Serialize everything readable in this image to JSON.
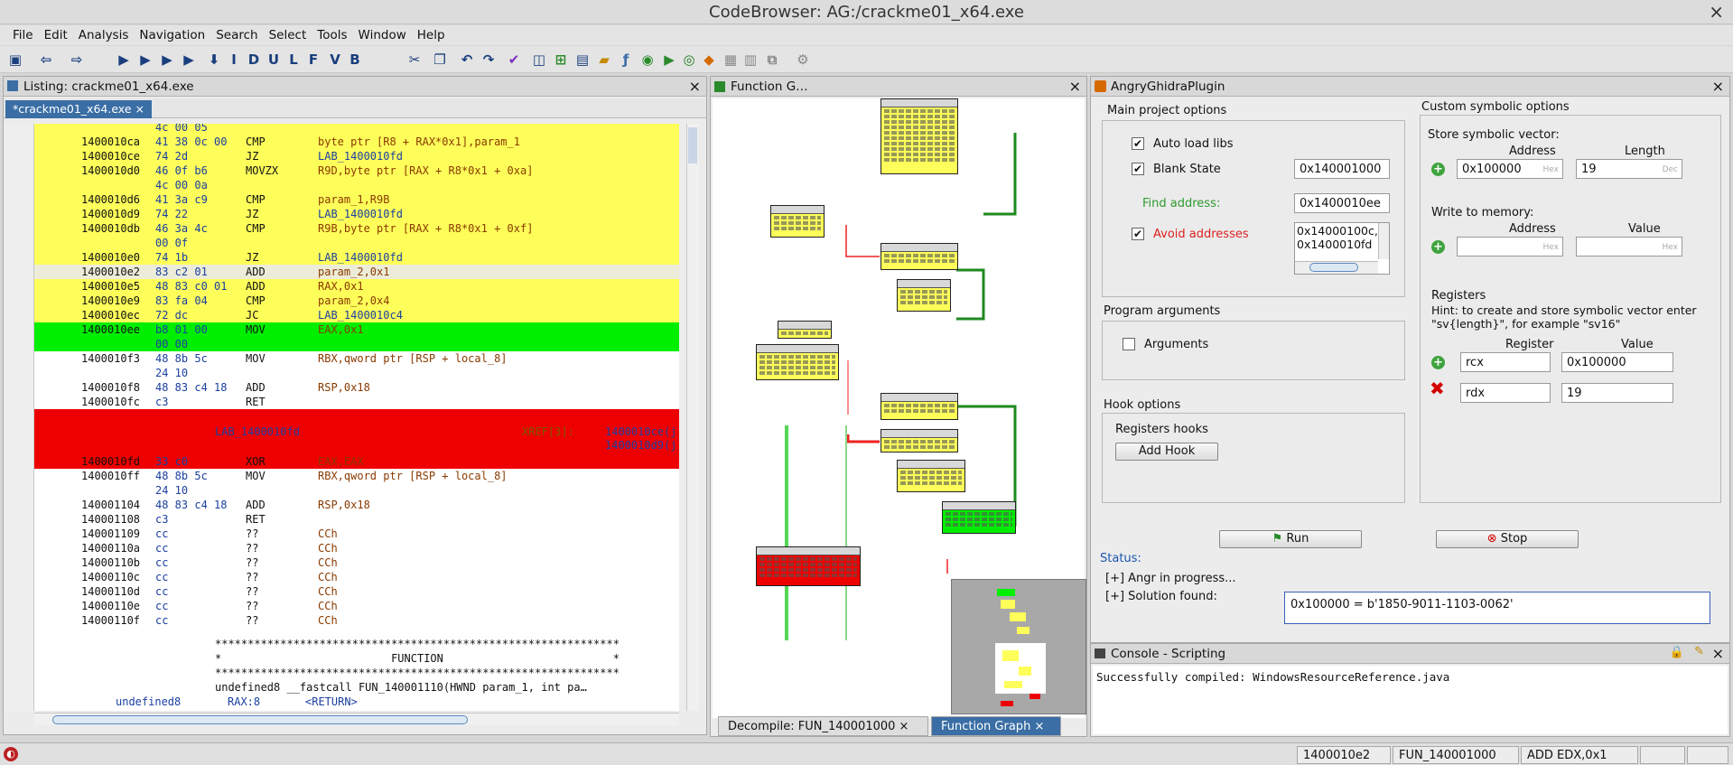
{
  "window": {
    "title": "CodeBrowser: AG:/crackme01_x64.exe",
    "close_glyph": "×"
  },
  "menu": [
    "File",
    "Edit",
    "Analysis",
    "Navigation",
    "Search",
    "Select",
    "Tools",
    "Window",
    "Help"
  ],
  "toolbar": {
    "letters": [
      "I",
      "D",
      "U",
      "L",
      "F",
      "V",
      "B"
    ]
  },
  "listing": {
    "title": "Listing:  crackme01_x64.exe",
    "tab": "*crackme01_x64.exe",
    "rows": [
      {
        "bytes": "4c 00 05",
        "hl": "yellow"
      },
      {
        "addr": "1400010ca",
        "bytes": "41 38 0c 00",
        "mn": "CMP",
        "op": "byte ptr [R8 + RAX*0x1],param_1",
        "hl": "yellow"
      },
      {
        "addr": "1400010ce",
        "bytes": "74 2d",
        "mn": "JZ",
        "op": "LAB_1400010fd",
        "hl": "yellow"
      },
      {
        "addr": "1400010d0",
        "bytes": "46 0f b6",
        "mn": "MOVZX",
        "op": "R9D,byte ptr [RAX + R8*0x1 + 0xa]",
        "hl": "yellow"
      },
      {
        "bytes": "4c 00 0a",
        "hl": "yellow"
      },
      {
        "addr": "1400010d6",
        "bytes": "41 3a c9",
        "mn": "CMP",
        "op": "param_1,R9B",
        "hl": "yellow"
      },
      {
        "addr": "1400010d9",
        "bytes": "74 22",
        "mn": "JZ",
        "op": "LAB_1400010fd",
        "hl": "yellow"
      },
      {
        "addr": "1400010db",
        "bytes": "46 3a 4c",
        "mn": "CMP",
        "op": "R9B,byte ptr [RAX + R8*0x1 + 0xf]",
        "hl": "yellow"
      },
      {
        "bytes": "00 0f",
        "hl": "yellow"
      },
      {
        "addr": "1400010e0",
        "bytes": "74 1b",
        "mn": "JZ",
        "op": "LAB_1400010fd",
        "hl": "yellow"
      },
      {
        "addr": "1400010e2",
        "bytes": "83 c2 01",
        "mn": "ADD",
        "op": "param_2,0x1",
        "hl": "cursor"
      },
      {
        "addr": "1400010e5",
        "bytes": "48 83 c0 01",
        "mn": "ADD",
        "op": "RAX,0x1",
        "hl": "yellow"
      },
      {
        "addr": "1400010e9",
        "bytes": "83 fa 04",
        "mn": "CMP",
        "op": "param_2,0x4",
        "hl": "yellow"
      },
      {
        "addr": "1400010ec",
        "bytes": "72 dc",
        "mn": "JC",
        "op": "LAB_1400010c4",
        "hl": "yellow"
      },
      {
        "addr": "1400010ee",
        "bytes": "b8 01 00",
        "mn": "MOV",
        "op": "EAX,0x1",
        "hl": "green"
      },
      {
        "bytes": "00 00",
        "hl": "green"
      },
      {
        "addr": "1400010f3",
        "bytes": "48 8b 5c",
        "mn": "MOV",
        "op": "RBX,qword ptr [RSP + local_8]",
        "hl": "none"
      },
      {
        "bytes": "24 10",
        "hl": "none"
      },
      {
        "addr": "1400010f8",
        "bytes": "48 83 c4 18",
        "mn": "ADD",
        "op": "RSP,0x18",
        "hl": "none"
      },
      {
        "addr": "1400010fc",
        "bytes": "c3",
        "mn": "RET",
        "op": "",
        "hl": "none"
      }
    ],
    "lab_block": {
      "label": "LAB_1400010fd",
      "xref_title": "XREF[3]:",
      "xrefs": [
        "1400010ce(j),",
        "1400010d9(j),",
        "1400010e0(j)"
      ]
    },
    "rows2": [
      {
        "addr": "1400010fd",
        "bytes": "33 c0",
        "mn": "XOR",
        "op": "EAX,EAX",
        "hl": "red"
      },
      {
        "addr": "1400010ff",
        "bytes": "48 8b 5c",
        "mn": "MOV",
        "op": "RBX,qword ptr [RSP + local_8]",
        "hl": "none"
      },
      {
        "bytes": "24 10",
        "hl": "none"
      },
      {
        "addr": "140001104",
        "bytes": "48 83 c4 18",
        "mn": "ADD",
        "op": "RSP,0x18",
        "hl": "none"
      },
      {
        "addr": "140001108",
        "bytes": "c3",
        "mn": "RET",
        "op": "",
        "hl": "none"
      },
      {
        "addr": "140001109",
        "bytes": "cc",
        "mn": "??",
        "op": "CCh",
        "hl": "none"
      },
      {
        "addr": "14000110a",
        "bytes": "cc",
        "mn": "??",
        "op": "CCh",
        "hl": "none"
      },
      {
        "addr": "14000110b",
        "bytes": "cc",
        "mn": "??",
        "op": "CCh",
        "hl": "none"
      },
      {
        "addr": "14000110c",
        "bytes": "cc",
        "mn": "??",
        "op": "CCh",
        "hl": "none"
      },
      {
        "addr": "14000110d",
        "bytes": "cc",
        "mn": "??",
        "op": "CCh",
        "hl": "none"
      },
      {
        "addr": "14000110e",
        "bytes": "cc",
        "mn": "??",
        "op": "CCh",
        "hl": "none"
      },
      {
        "addr": "14000110f",
        "bytes": "cc",
        "mn": "??",
        "op": "CCh",
        "hl": "none"
      }
    ],
    "func_banner": {
      "stars": "**************************************************************",
      "title": "*                          FUNCTION                          *",
      "signature": "undefined8 __fastcall FUN_140001110(HWND param_1, int pa…",
      "ret_type": "undefined8",
      "ret_reg": "RAX:8",
      "ret_name": "<RETURN>"
    }
  },
  "graph": {
    "title": "Function G…",
    "tabs": [
      "Decompile: FUN_140001000",
      "Function Graph"
    ]
  },
  "plugin": {
    "title": "AngryGhidraPlugin",
    "main_options": "Main project options",
    "auto_load_libs": "Auto load libs",
    "blank_state": "Blank State",
    "blank_state_value": "0x140001000",
    "find_address_label": "Find address:",
    "find_address_value": "0x1400010ee",
    "avoid_label": "Avoid addresses",
    "avoid_values": [
      "0x14000100c,",
      "0x1400010fd"
    ],
    "program_args": "Program arguments",
    "arguments": "Arguments",
    "hook_options": "Hook options",
    "registers_hooks": "Registers hooks",
    "add_hook": "Add Hook",
    "custom_symbolic": "Custom symbolic options",
    "store_symbolic": "Store symbolic vector:",
    "address_col": "Address",
    "length_col": "Length",
    "store_address": "0x100000",
    "store_length": "19",
    "hint_hex": "Hex",
    "hint_dec": "Dec",
    "write_memory": "Write to memory:",
    "value_col": "Value",
    "registers": "Registers",
    "registers_hint1": "Hint: to create and store symbolic vector enter",
    "registers_hint2": "\"sv{length}\", for example \"sv16\"",
    "register_col": "Register",
    "reg_rows": [
      {
        "reg": "rcx",
        "val": "0x100000"
      },
      {
        "reg": "rdx",
        "val": "19"
      }
    ],
    "run": "Run",
    "stop": "Stop",
    "status": "Status:",
    "status_lines": [
      "[+] Angr in progress...",
      "[+] Solution found:"
    ],
    "solution": "0x100000 = b'1850-9011-1103-0062'"
  },
  "console": {
    "title": "Console - Scripting",
    "output": "Successfully compiled: WindowsResourceReference.java"
  },
  "status": {
    "address": "1400010e2",
    "function": "FUN_140001000",
    "instruction": "ADD EDX,0x1"
  },
  "colors": {
    "highlight_yellow": "#fefe5a",
    "highlight_green": "#00ee00",
    "highlight_red": "#ee0000",
    "tab_active": "#3a6ea5"
  }
}
